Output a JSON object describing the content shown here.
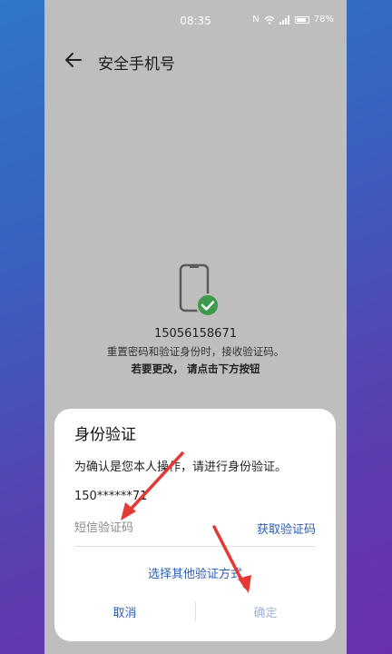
{
  "status_bar": {
    "time": "08:35",
    "battery": "78%",
    "nfc": "N"
  },
  "header": {
    "title": "安全手机号"
  },
  "info": {
    "phone_number": "15056158671",
    "description": "重置密码和验证身份时，接收验证码。",
    "hint": "若要更改，  请点击下方按钮"
  },
  "dialog": {
    "title": "身份验证",
    "message": "为确认是您本人操作，请进行身份验证。",
    "masked_number": "150******71",
    "code_placeholder": "短信验证码",
    "get_code_label": "获取验证码",
    "other_method_label": "选择其他验证方式",
    "cancel_label": "取消",
    "confirm_label": "确定"
  },
  "colors": {
    "accent": "#2a5db0",
    "confirm_disabled": "#9fb4d8",
    "annotation_arrow": "#e53935",
    "check_badge": "#3f9b4c"
  }
}
